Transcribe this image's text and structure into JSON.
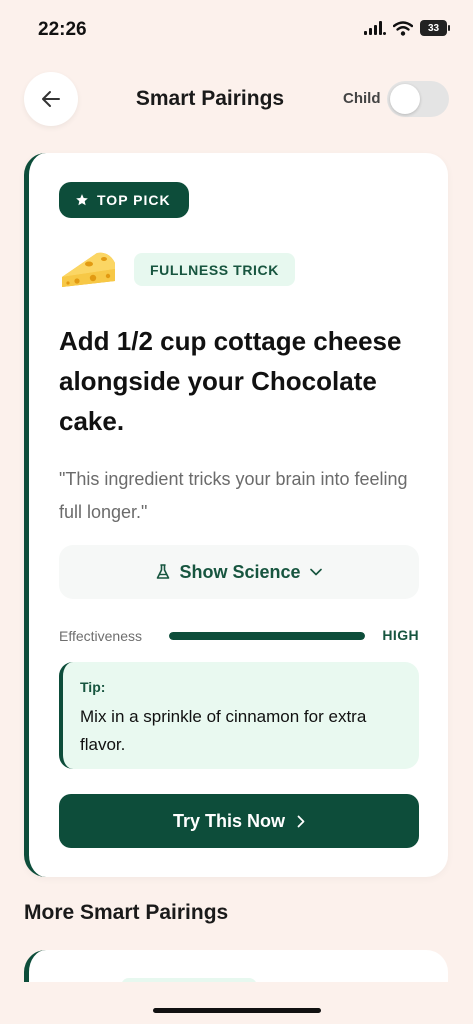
{
  "status_bar": {
    "time": "22:26",
    "battery": "33"
  },
  "header": {
    "title": "Smart Pairings",
    "child_label": "Child",
    "child_toggle_on": false
  },
  "top_pick": {
    "badge": "TOP PICK",
    "category": "FULLNESS TRICK",
    "headline": "Add 1/2 cup cottage cheese alongside your Chocolate cake.",
    "quote": "\"This ingredient tricks your brain into feeling full longer.\"",
    "science_button": "Show Science",
    "effectiveness": {
      "label": "Effectiveness",
      "level": "HIGH",
      "fraction": 1.0
    },
    "tip": {
      "label": "Tip:",
      "text": "Mix in a sprinkle of cinnamon for extra flavor."
    },
    "cta": "Try This Now"
  },
  "more_section": {
    "title": "More Smart Pairings"
  },
  "colors": {
    "brand_green": "#0d4d3a",
    "background": "#fcf1ec",
    "badge_mint": "#e7f8ef"
  }
}
